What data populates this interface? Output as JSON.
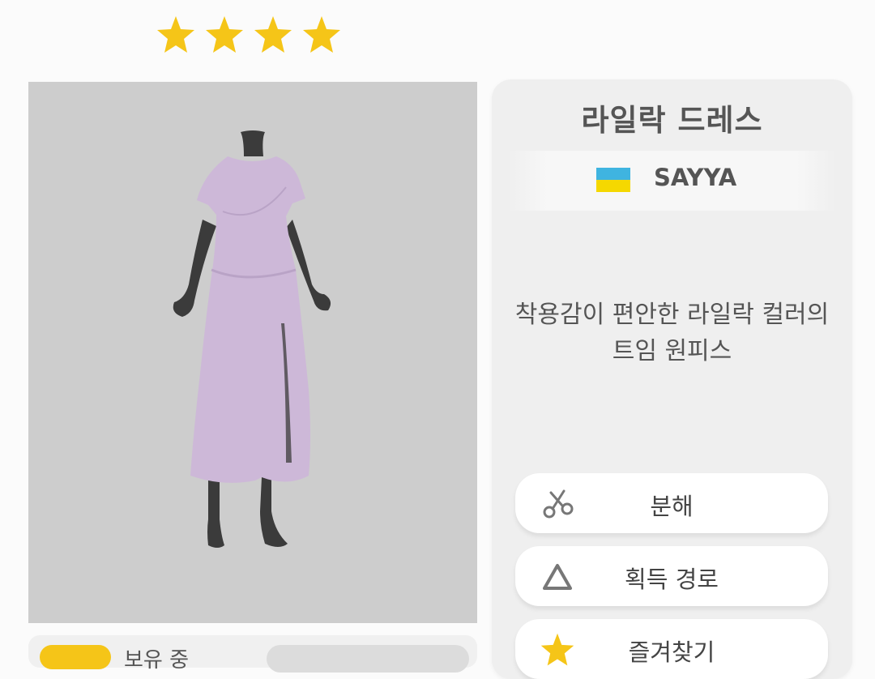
{
  "rating": {
    "stars": 4
  },
  "item": {
    "name": "라일락 드레스",
    "brand": "SAYYA",
    "flag": "ukraine-flag",
    "description_line1": "착용감이 편안한 라일락 컬러의",
    "description_line2": "트임 원피스"
  },
  "owned": {
    "label": "보유 중"
  },
  "actions": [
    {
      "label": "분해",
      "icon": "scissors-icon"
    },
    {
      "label": "획득 경로",
      "icon": "triangle-icon"
    },
    {
      "label": "즐겨찾기",
      "icon": "star-icon"
    }
  ],
  "colors": {
    "star": "#f5c518",
    "dress": "#cdb8d8",
    "mannequin": "#3b3b3b",
    "preview_bg": "#cdcdcd"
  }
}
